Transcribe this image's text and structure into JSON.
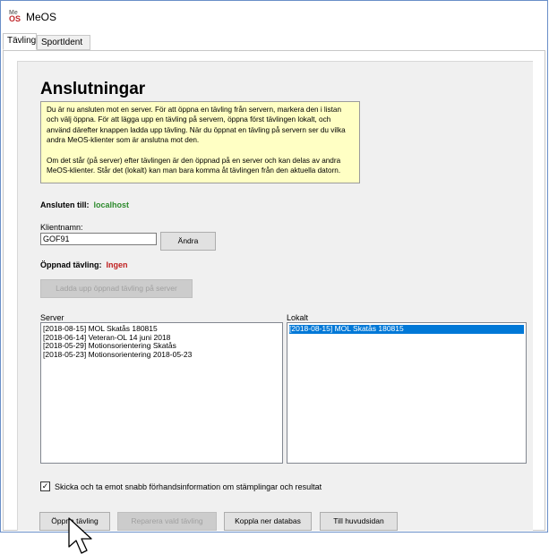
{
  "window": {
    "title": "MeOS"
  },
  "tabs": [
    "Tävling",
    "SportIdent"
  ],
  "page": {
    "heading": "Anslutningar",
    "info": [
      "Du är nu ansluten mot en server. För att öppna en tävling från servern, markera den i listan och välj öppna. För att lägga upp en tävling på servern, öppna först tävlingen lokalt, och använd därefter knappen ladda upp tävling. När du öppnat en tävling på servern ser du vilka andra MeOS-klienter som är anslutna mot den.",
      "Om det står (på server) efter tävlingen är den öppnad på en server och kan delas av andra MeOS-klienter. Står det (lokalt) kan man bara komma åt tävlingen från den aktuella datorn."
    ],
    "connected_label": "Ansluten till:",
    "connected_value": "localhost",
    "client_name_label": "Klientnamn:",
    "client_name_value": "GOF91",
    "change_button": "Ändra",
    "opened_label": "Öppnad tävling:",
    "opened_value": "Ingen",
    "upload_button": "Ladda upp öppnad tävling på server",
    "server_label": "Server",
    "local_label": "Lokalt",
    "server_items": [
      "[2018-08-15] MOL Skatås 180815",
      "[2018-06-14] Veteran-OL 14 juni 2018",
      "[2018-05-29] Motionsorientering Skatås",
      "[2018-05-23] Motionsorientering 2018-05-23"
    ],
    "local_items": [
      "[2018-08-15] MOL Skatås 180815"
    ],
    "checkbox_label": "Skicka och ta emot snabb förhandsinformation om stämplingar och resultat",
    "checkbox_checked": true,
    "buttons": {
      "open": "Öppna tävling",
      "repair": "Reparera vald tävling",
      "disconnect": "Koppla ner databas",
      "main": "Till huvudsidan"
    }
  }
}
